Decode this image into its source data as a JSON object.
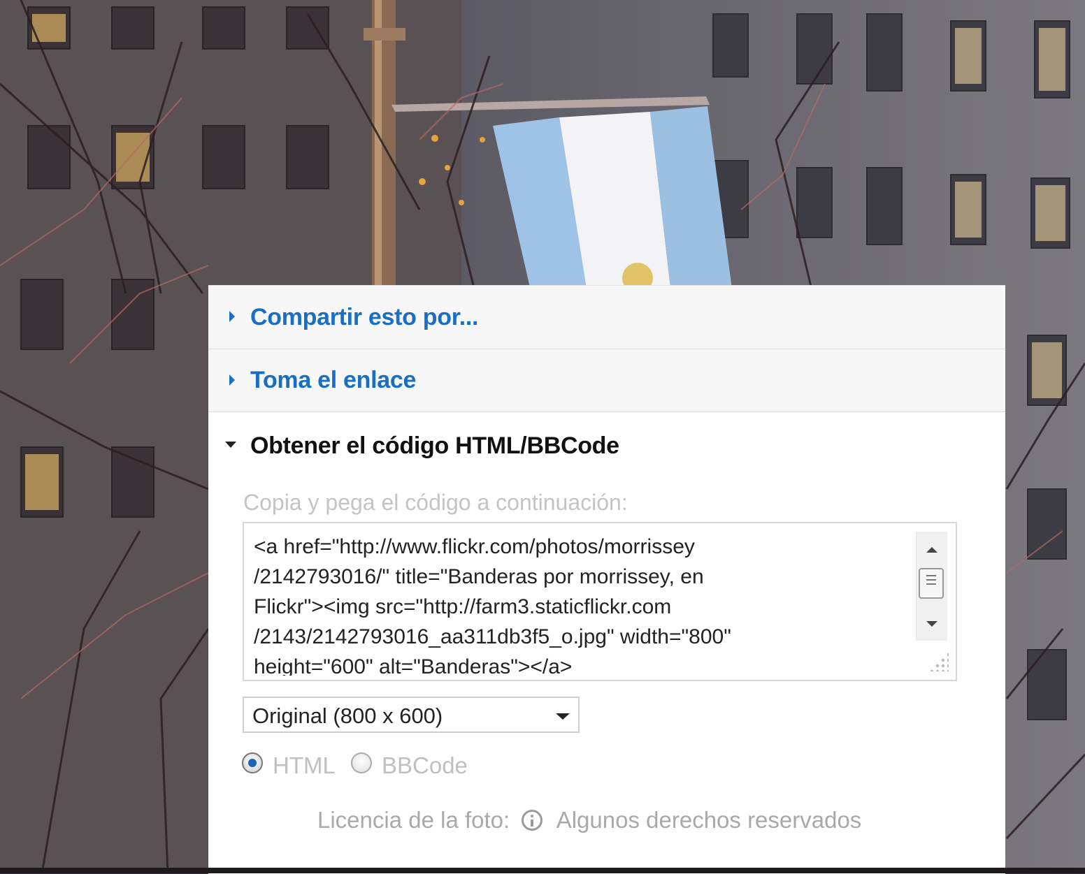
{
  "accordion": {
    "share_label": "Compartir esto por...",
    "link_label": "Toma el enlace",
    "embed_label": "Obtener el código HTML/BBCode"
  },
  "embed": {
    "instruction": "Copia y pega el código a continuación:",
    "code": "<a href=\"http://www.flickr.com/photos/morrissey\n/2142793016/\" title=\"Banderas por morrissey, en\nFlickr\"><img src=\"http://farm3.staticflickr.com\n/2143/2142793016_aa311db3f5_o.jpg\" width=\"800\"\nheight=\"600\" alt=\"Banderas\"></a>",
    "size_selected": "Original (800 x 600)",
    "format_html": "HTML",
    "format_bbcode": "BBCode",
    "selected_format": "HTML"
  },
  "license": {
    "label": "Licencia de la foto:",
    "value": "Algunos derechos reservados"
  },
  "colors": {
    "link_blue": "#1a6fc4",
    "panel_bg": "#ffffff",
    "muted_text": "#c0c0c0"
  }
}
